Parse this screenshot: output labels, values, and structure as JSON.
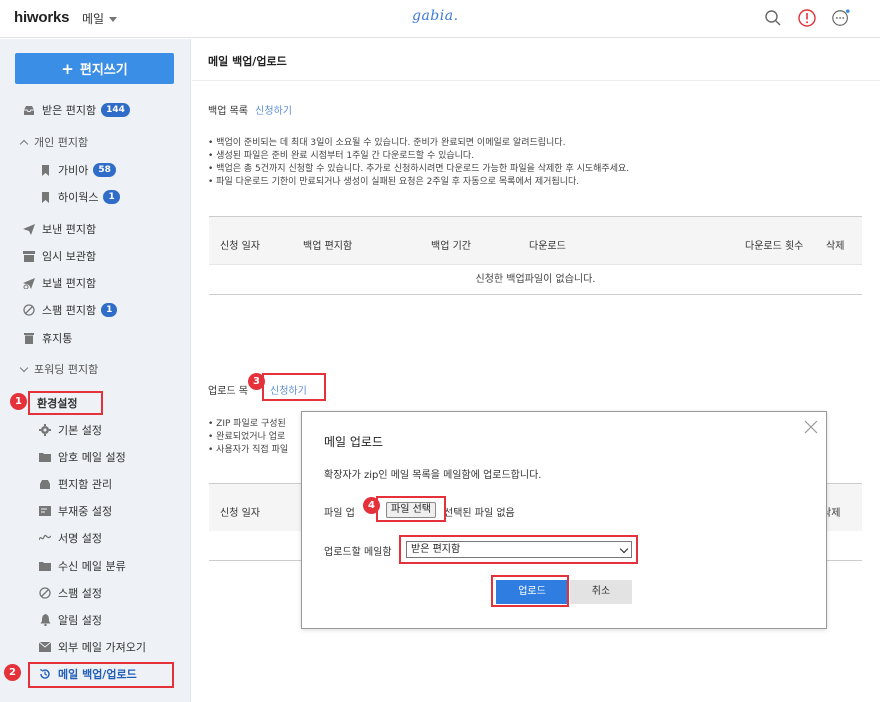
{
  "header": {
    "logo": "hiworks",
    "app_name": "메일",
    "brand": "gabia."
  },
  "sidebar": {
    "compose_label": "편지쓰기",
    "inbox": {
      "label": "받은 편지함",
      "count": "144"
    },
    "personal_folders": {
      "label": "개인 편지함",
      "items": [
        {
          "label": "가비아",
          "count": "58"
        },
        {
          "label": "하이웍스",
          "count": "1"
        }
      ]
    },
    "sent": "보낸 편지함",
    "drafts": "임시 보관함",
    "scheduled": "보낼 편지함",
    "spam": {
      "label": "스팸 편지함",
      "count": "1"
    },
    "trash": "휴지통",
    "forwarding": "포워딩 편지함",
    "settings": {
      "label": "환경설정",
      "items": [
        "기본 설정",
        "암호 메일 설정",
        "편지함 관리",
        "부재중 설정",
        "서명 설정",
        "수신 메일 분류",
        "스팸 설정",
        "알림 설정",
        "외부 메일 가져오기",
        "메일 백업/업로드"
      ]
    }
  },
  "main": {
    "title": "메일 백업/업로드",
    "backup": {
      "section_label": "백업 목록",
      "request_link": "신청하기",
      "notes": [
        "• 백업이 준비되는 데 최대 3일이 소요될 수 있습니다. 준비가 완료되면 이메일로 알려드립니다.",
        "• 생성된 파일은 준비 완료 시점부터 1주일 간 다운로드할 수 있습니다.",
        "• 백업은 총 5건까지 신청할 수 있습니다. 추가로 신청하시려면 다운로드 가능한 파일을 삭제한 후 시도해주세요.",
        "• 파일 다운로드 기한이 만료되거나 생성이 실패된 요청은 2주일 후 자동으로 목록에서 제거됩니다."
      ],
      "columns": [
        "신청 일자",
        "백업 편지함",
        "백업 기간",
        "다운로드",
        "다운로드 횟수",
        "삭제"
      ],
      "empty": "신청한 백업파일이 없습니다."
    },
    "upload": {
      "section_label": "업로드 목",
      "request_link": "신청하기",
      "notes": [
        "• ZIP 파일로 구성된",
        "• 완료되었거나 업로",
        "• 사용자가 직접 파일"
      ],
      "columns": [
        "신청 일자",
        "삭제"
      ]
    }
  },
  "modal": {
    "title": "메일 업로드",
    "description": "확장자가 zip인 메일 목록을 메일함에 업로드합니다.",
    "file_label": "파일 업",
    "file_button": "파일 선택",
    "file_status": "선택된 파일 없음",
    "mailbox_label": "업로드할 메일함",
    "mailbox_selected": "받은 편지함",
    "upload_button": "업로드",
    "cancel_button": "취소"
  },
  "steps": [
    "1",
    "2",
    "3",
    "4"
  ],
  "colors": {
    "accent": "#3a8ee6",
    "badge": "#2f6dc9",
    "highlight": "#e4313a",
    "sidebar_bg": "#eef1f6"
  }
}
